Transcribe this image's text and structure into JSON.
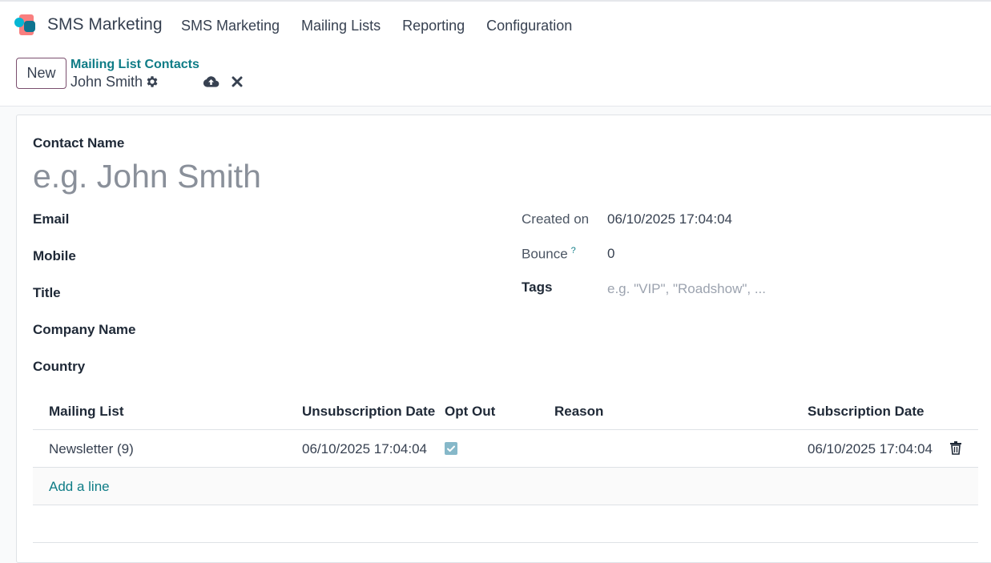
{
  "navbar": {
    "brand": "SMS Marketing",
    "menu": [
      {
        "label": "SMS Marketing"
      },
      {
        "label": "Mailing Lists"
      },
      {
        "label": "Reporting"
      },
      {
        "label": "Configuration"
      }
    ]
  },
  "control": {
    "new_label": "New",
    "breadcrumb_parent": "Mailing List Contacts",
    "breadcrumb_current": "John Smith"
  },
  "form": {
    "contact_name_label": "Contact Name",
    "contact_name_value": "",
    "contact_name_placeholder": "e.g. John Smith",
    "email_label": "Email",
    "mobile_label": "Mobile",
    "title_label": "Title",
    "company_label": "Company Name",
    "country_label": "Country",
    "created_on_label": "Created on",
    "created_on_value": "06/10/2025 17:04:04",
    "bounce_label": "Bounce",
    "bounce_help": "?",
    "bounce_value": "0",
    "tags_label": "Tags",
    "tags_placeholder": "e.g. \"VIP\", \"Roadshow\", ..."
  },
  "subscriptions": {
    "columns": {
      "mailing_list": "Mailing List",
      "unsubscription_date": "Unsubscription Date",
      "opt_out": "Opt Out",
      "reason": "Reason",
      "subscription_date": "Subscription Date"
    },
    "rows": [
      {
        "mailing_list": "Newsletter (9)",
        "unsubscription_date": "06/10/2025 17:04:04",
        "opt_out": true,
        "reason": "",
        "subscription_date": "06/10/2025 17:04:04"
      }
    ],
    "add_line": "Add a line"
  },
  "colors": {
    "accent": "#0e7c86",
    "new_button_border": "#7b4f6e",
    "checkbox": "#86b8c9"
  },
  "icons": [
    "app-logo-icon",
    "gear-icon",
    "cloud-upload-icon",
    "close-icon",
    "checkmark-icon",
    "trash-icon"
  ]
}
